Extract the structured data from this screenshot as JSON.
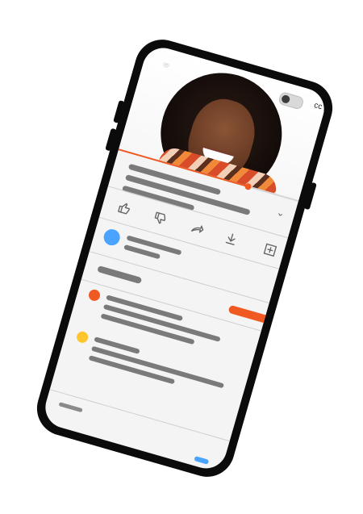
{
  "app": {
    "accent_color": "#f05a22",
    "avatar_colors": [
      "#4aa3ff",
      "#f05a22",
      "#ffc52e"
    ],
    "icons": {
      "collapse": "chevron-down-icon",
      "like": "thumbs-up-icon",
      "dislike": "thumbs-down-icon",
      "share": "share-arrow-icon",
      "download": "download-icon",
      "save": "add-to-playlist-icon",
      "expand": "chevron-down-icon"
    }
  },
  "video": {
    "captions_label": "cc",
    "progress_percent": 72
  }
}
